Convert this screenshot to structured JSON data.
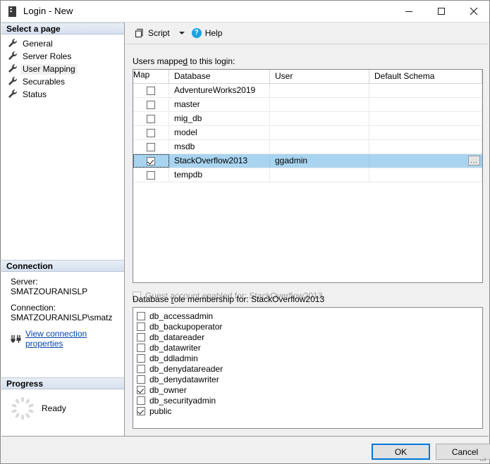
{
  "window": {
    "title": "Login - New",
    "icon": "server-icon",
    "controls": {
      "minimize": "minimize-icon",
      "maximize": "maximize-icon",
      "close": "close-icon"
    }
  },
  "sidebar": {
    "select_page_header": "Select a page",
    "pages": [
      {
        "label": "General",
        "selected": false
      },
      {
        "label": "Server Roles",
        "selected": false
      },
      {
        "label": "User Mapping",
        "selected": true
      },
      {
        "label": "Securables",
        "selected": false
      },
      {
        "label": "Status",
        "selected": false
      }
    ],
    "connection": {
      "header": "Connection",
      "server_label": "Server:",
      "server_value": "SMATZOURANISLP",
      "connection_label": "Connection:",
      "connection_value": "SMATZOURANISLP\\smatz",
      "view_properties_link": "View connection properties"
    },
    "progress": {
      "header": "Progress",
      "status": "Ready"
    }
  },
  "toolbar": {
    "script_label": "Script",
    "help_label": "Help",
    "script_icon": "script-icon",
    "dropdown_icon": "chevron-down-icon",
    "help_icon": "help-icon"
  },
  "main": {
    "users_label_pre": "Users mappe",
    "users_label_accel": "d",
    "users_label_post": " to this login:",
    "grid": {
      "columns": [
        "Map",
        "Database",
        "User",
        "Default Schema"
      ],
      "rows": [
        {
          "map": false,
          "database": "AdventureWorks2019",
          "user": "",
          "schema": "",
          "selected": false
        },
        {
          "map": false,
          "database": "master",
          "user": "",
          "schema": "",
          "selected": false
        },
        {
          "map": false,
          "database": "mig_db",
          "user": "",
          "schema": "",
          "selected": false
        },
        {
          "map": false,
          "database": "model",
          "user": "",
          "schema": "",
          "selected": false
        },
        {
          "map": false,
          "database": "msdb",
          "user": "",
          "schema": "",
          "selected": false
        },
        {
          "map": true,
          "database": "StackOverflow2013",
          "user": "ggadmin",
          "schema": "",
          "selected": true,
          "browse_button": "..."
        },
        {
          "map": false,
          "database": "tempdb",
          "user": "",
          "schema": "",
          "selected": false
        }
      ]
    },
    "guest": {
      "checked": false,
      "enabled": false,
      "label": "Guest account enabled for: StackOverflow2013"
    },
    "roles_label_pre": "Database ",
    "roles_label_accel": "r",
    "roles_label_post": "ole membership for: StackOverflow2013",
    "roles": [
      {
        "name": "db_accessadmin",
        "checked": false
      },
      {
        "name": "db_backupoperator",
        "checked": false
      },
      {
        "name": "db_datareader",
        "checked": false
      },
      {
        "name": "db_datawriter",
        "checked": false
      },
      {
        "name": "db_ddladmin",
        "checked": false
      },
      {
        "name": "db_denydatareader",
        "checked": false
      },
      {
        "name": "db_denydatawriter",
        "checked": false
      },
      {
        "name": "db_owner",
        "checked": true
      },
      {
        "name": "db_securityadmin",
        "checked": false
      },
      {
        "name": "public",
        "checked": true
      }
    ]
  },
  "footer": {
    "ok_label": "OK",
    "cancel_label": "Cancel"
  },
  "colors": {
    "selection_blue": "#a8d4f0",
    "focus_blue": "#0078d7",
    "link_blue": "#0645ad",
    "help_icon_blue": "#1ba1e2",
    "disabled_gray": "#9a9a9a"
  }
}
